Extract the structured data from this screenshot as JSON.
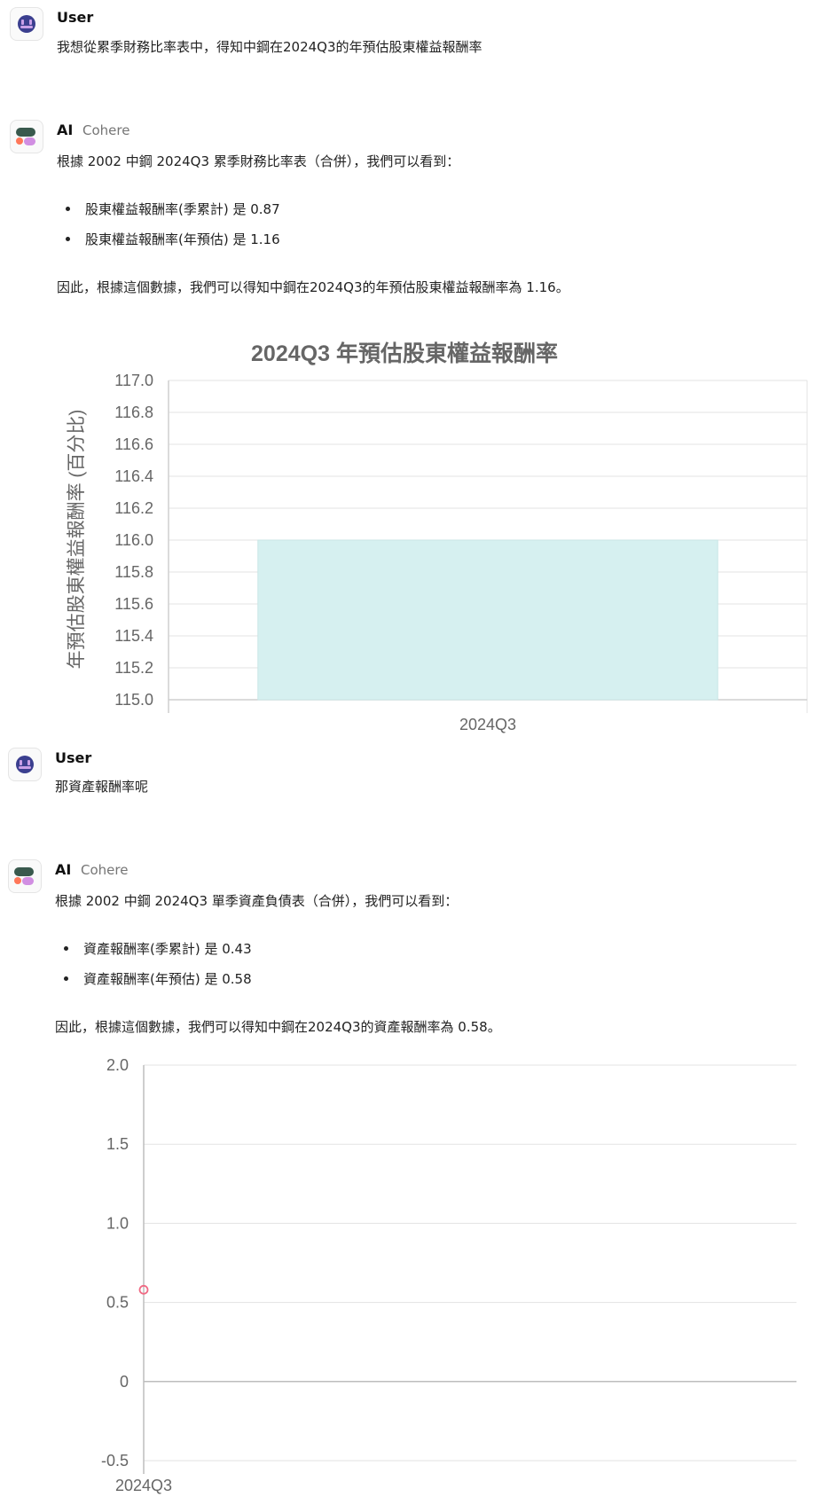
{
  "conversation": {
    "m1": {
      "sender": "User",
      "text": "我想從累季財務比率表中，得知中鋼在2024Q3的年預估股東權益報酬率"
    },
    "m2": {
      "sender": "AI",
      "model": "Cohere",
      "intro": "根據 2002 中鋼 2024Q3 累季財務比率表（合併），我們可以看到：",
      "bullets": [
        "股東權益報酬率(季累計) 是 0.87",
        "股東權益報酬率(年預估) 是 1.16"
      ],
      "conclusion": "因此，根據這個數據，我們可以得知中鋼在2024Q3的年預估股東權益報酬率為 1.16。"
    },
    "m3": {
      "sender": "User",
      "text": "那資產報酬率呢"
    },
    "m4": {
      "sender": "AI",
      "model": "Cohere",
      "intro": "根據 2002 中鋼 2024Q3 單季資產負債表（合併），我們可以看到：",
      "bullets": [
        "資產報酬率(季累計) 是 0.43",
        "資產報酬率(年預估) 是 0.58"
      ],
      "conclusion": "因此，根據這個數據，我們可以得知中鋼在2024Q3的資產報酬率為 0.58。"
    }
  },
  "chart_data": [
    {
      "type": "bar",
      "title": "2024Q3 年預估股東權益報酬率",
      "ylabel": "年預估股東權益報酬率 (百分比)",
      "xlabel": "",
      "categories": [
        "2024Q3"
      ],
      "values": [
        116.0
      ],
      "ylim": [
        115.0,
        117.0
      ],
      "yticks": [
        "115.0",
        "115.2",
        "115.4",
        "115.6",
        "115.8",
        "116.0",
        "116.2",
        "116.4",
        "116.6",
        "116.8",
        "117.0"
      ],
      "grid": true,
      "colors": {
        "bar": "#d6f0f0",
        "bar_edge": "#c9e6e6"
      }
    },
    {
      "type": "scatter",
      "title": "",
      "xlabel": "",
      "ylabel": "",
      "categories": [
        "2024Q3"
      ],
      "values": [
        0.58
      ],
      "ylim": [
        -0.5,
        2.0
      ],
      "yticks": [
        "-0.5",
        "0",
        "0.5",
        "1.0",
        "1.5",
        "2.0"
      ],
      "grid": true,
      "colors": {
        "point": "#f06a84"
      }
    }
  ]
}
